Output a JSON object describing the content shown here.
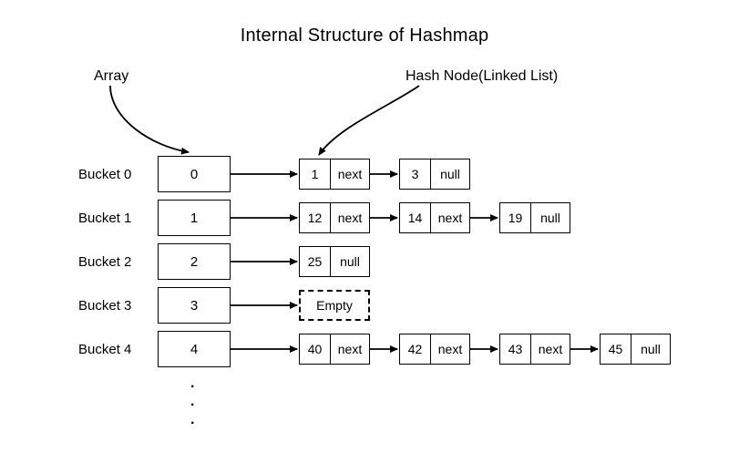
{
  "title": "Internal Structure of Hashmap",
  "labels": {
    "array": "Array",
    "hashnode": "Hash Node(Linked List)",
    "empty": "Empty",
    "null": "null",
    "next": "next"
  },
  "buckets": [
    {
      "label": "Bucket 0",
      "index": "0"
    },
    {
      "label": "Bucket 1",
      "index": "1"
    },
    {
      "label": "Bucket 2",
      "index": "2"
    },
    {
      "label": "Bucket 3",
      "index": "3"
    },
    {
      "label": "Bucket 4",
      "index": "4"
    }
  ],
  "chains": {
    "row0": [
      {
        "value": "1",
        "ptr": "next"
      },
      {
        "value": "3",
        "ptr": "null"
      }
    ],
    "row1": [
      {
        "value": "12",
        "ptr": "next"
      },
      {
        "value": "14",
        "ptr": "next"
      },
      {
        "value": "19",
        "ptr": "null"
      }
    ],
    "row2": [
      {
        "value": "25",
        "ptr": "null"
      }
    ],
    "row3": "empty",
    "row4": [
      {
        "value": "40",
        "ptr": "next"
      },
      {
        "value": "42",
        "ptr": "next"
      },
      {
        "value": "43",
        "ptr": "next"
      },
      {
        "value": "45",
        "ptr": "null"
      }
    ]
  },
  "dots": [
    ".",
    ".",
    "."
  ]
}
